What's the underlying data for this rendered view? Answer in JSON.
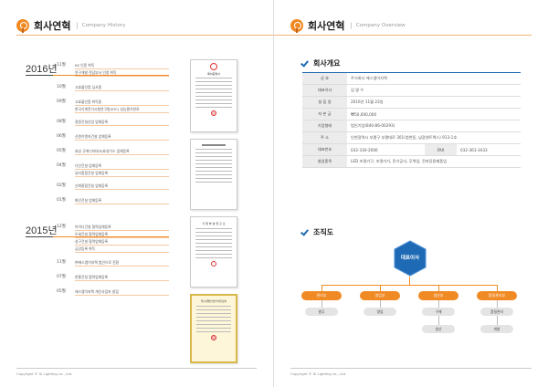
{
  "left": {
    "title": "회사연혁",
    "subtitle": "Company History",
    "footer": "Copyright © SI Lighting co., Ltd.",
    "years": [
      {
        "year": "2016년",
        "entries": [
          {
            "month": "11월",
            "items": [
              "KS 인증 취득",
              "연구개발 전담부서 인정 취득"
            ]
          },
          {
            "month": "10월",
            "items": [
              "고효율인증 심사중"
            ]
          },
          {
            "month": "09월",
            "items": [
              "고효율인증 취득중",
              "한국기계전기시험연구원(KTC) 성능평가완료"
            ]
          },
          {
            "month": "08월",
            "items": [
              "정원건설산업 업체등록"
            ]
          },
          {
            "month": "06월",
            "items": [
              "신원이앤지건설 업체등록"
            ]
          },
          {
            "month": "05월",
            "items": [
              "효성 굿에너지테크/효성이스 업체등록"
            ]
          },
          {
            "month": "04월",
            "items": [
              "다인건설 업체등록",
              "뷰티종합건설 업체등록"
            ]
          },
          {
            "month": "02월",
            "items": [
              "신화종합건설 업체등록"
            ]
          },
          {
            "month": "01월",
            "items": [
              "화인건설 업체등록"
            ]
          }
        ]
      },
      {
        "year": "2015년",
        "entries": [
          {
            "month": "12월",
            "items": [
              "아이디건설 협력업체등록",
              "두세건설 협력업체등록",
              "성구건설 협력업체등록",
              "금강등록 취득"
            ]
          },
          {
            "month": "11월",
            "items": [
              "㈜에스엠이지렉 법인으로 전환"
            ]
          },
          {
            "month": "07월",
            "items": [
              "한흥건설 협력업체등록"
            ]
          },
          {
            "month": "05월",
            "items": [
              "에스엠이지렉 개인사업자 창립"
            ]
          }
        ]
      }
    ],
    "doc_labels": {
      "cert1": "특허증명서",
      "cert3": "기 업 부 설 연 구 소",
      "cert4": "연구개발전담부서인정서"
    }
  },
  "right": {
    "title": "회사연혁",
    "subtitle": "Company Overview",
    "footer": "Copyright © SI Lighting co., Ltd.",
    "overview_heading": "회사개요",
    "rows": [
      {
        "label": "상 호",
        "value": "주식회사 에스엠이지렉"
      },
      {
        "label": "대표이사",
        "value": "김 영 수"
      },
      {
        "label": "설 립 일",
        "value": "2016년 11월 23일"
      },
      {
        "label": "자 본 금",
        "value": "₩50,000,000"
      },
      {
        "label": "기업형태",
        "value": "법인기업(840-86-00293)"
      },
      {
        "label": "주 소",
        "value": "인천광역시 부평구 부평대로 301(청천동, 남광센트렉스) 913-1호"
      },
      {
        "label": "대표번호",
        "value": "032-330-2006",
        "fax_label": "FAX",
        "fax_value": "032-363-3433"
      },
      {
        "label": "영업종목",
        "value": "LED 조명기구, 조명기기, 전기공사, 무역업, 전자응용제품업"
      }
    ],
    "org_heading": "조직도",
    "ceo": "대표이사",
    "departments": [
      {
        "name": "관리부",
        "teams": [
          "총무"
        ]
      },
      {
        "name": "영업부",
        "teams": [
          "영업"
        ]
      },
      {
        "name": "생산부",
        "teams": [
          "구매",
          "생산"
        ]
      },
      {
        "name": "품질관리부",
        "teams": [
          "품질관리",
          "개발"
        ]
      }
    ]
  },
  "colors": {
    "accent": "#f08a24",
    "blue": "#1e6ab4"
  }
}
